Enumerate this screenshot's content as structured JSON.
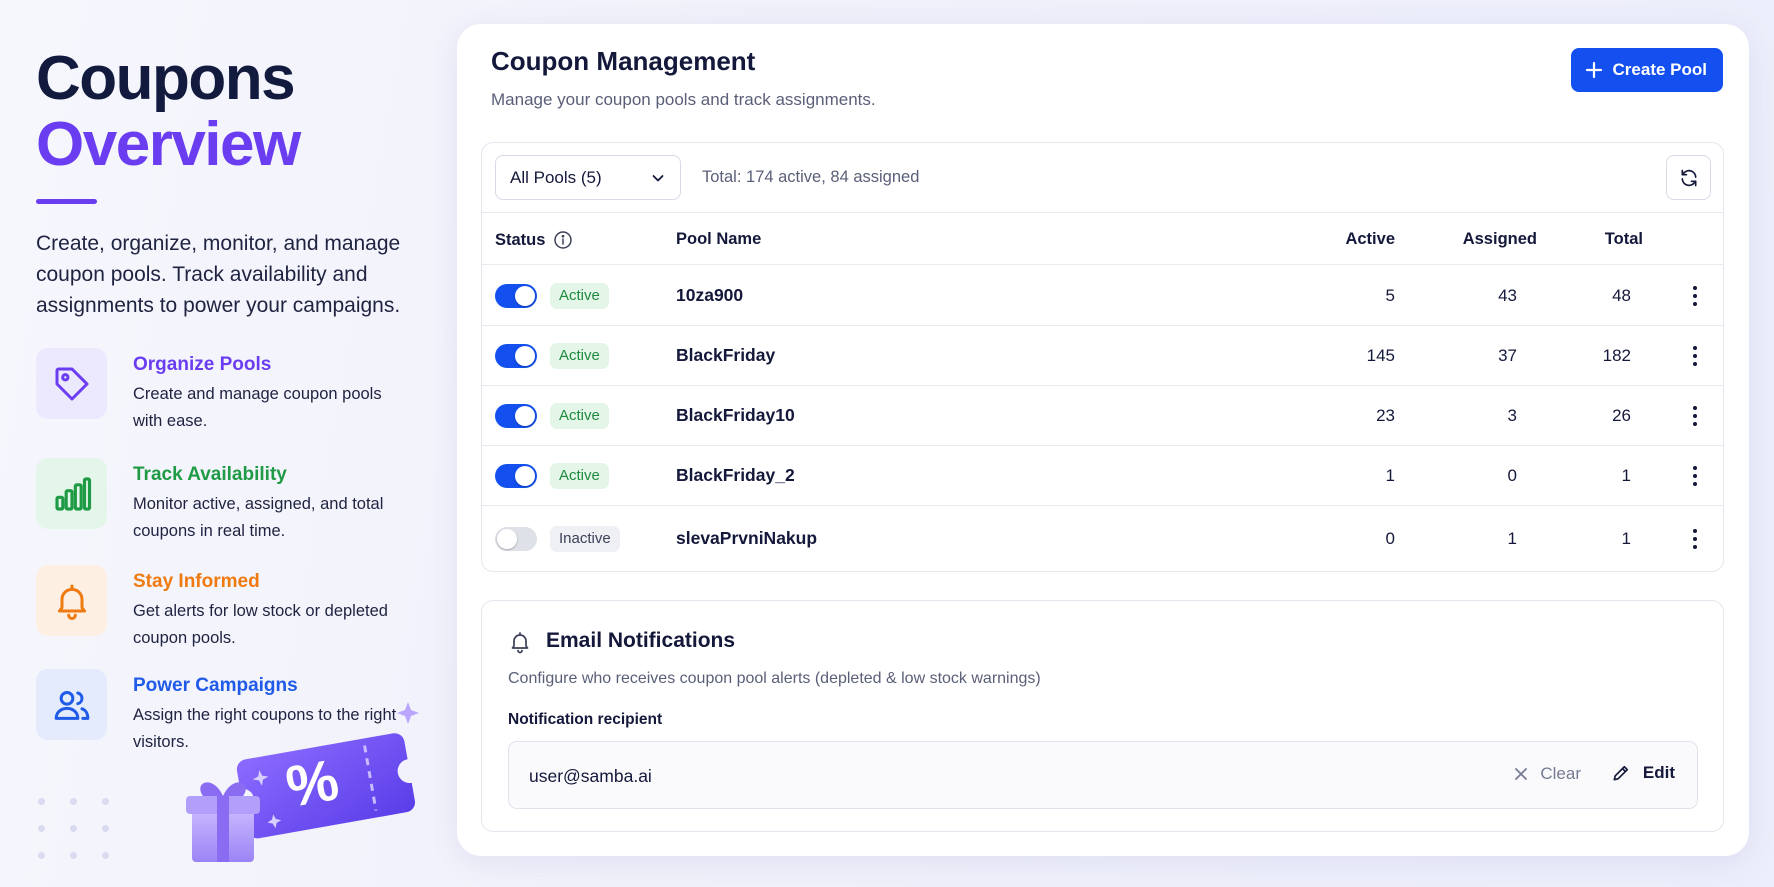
{
  "hero": {
    "title_line1": "Coupons",
    "title_line2": "Overview",
    "description": "Create, organize, monitor, and manage coupon pools. Track availability and assignments to power your campaigns."
  },
  "features": [
    {
      "title": "Organize Pools",
      "description": "Create and manage coupon pools with ease.",
      "icon": "tag-icon",
      "color": "#6a3df0",
      "bg": "#ece8fd"
    },
    {
      "title": "Track Availability",
      "description": "Monitor active, assigned, and total coupons in real time.",
      "icon": "bar-chart-icon",
      "color": "#1f9a45",
      "bg": "#e4f6e9"
    },
    {
      "title": "Stay Informed",
      "description": "Get alerts for low stock or depleted coupon pools.",
      "icon": "bell-icon",
      "color": "#f07a12",
      "bg": "#fdf0e3"
    },
    {
      "title": "Power Campaigns",
      "description": "Assign the right coupons to the right visitors.",
      "icon": "users-icon",
      "color": "#1f5ae8",
      "bg": "#e3ebfd"
    }
  ],
  "illustration": {
    "coupon_symbol": "%"
  },
  "main": {
    "title": "Coupon Management",
    "subtitle": "Manage your coupon pools and track assignments.",
    "create_button": "Create Pool"
  },
  "pools": {
    "filter_value": "All Pools (5)",
    "total_text": "Total: 174 active, 84 assigned",
    "columns": {
      "status": "Status",
      "name": "Pool Name",
      "active": "Active",
      "assigned": "Assigned",
      "total": "Total"
    },
    "rows": [
      {
        "enabled": true,
        "status": "Active",
        "name": "10za900",
        "active": "5",
        "assigned": "43",
        "total": "48"
      },
      {
        "enabled": true,
        "status": "Active",
        "name": "BlackFriday",
        "active": "145",
        "assigned": "37",
        "total": "182"
      },
      {
        "enabled": true,
        "status": "Active",
        "name": "BlackFriday10",
        "active": "23",
        "assigned": "3",
        "total": "26"
      },
      {
        "enabled": true,
        "status": "Active",
        "name": "BlackFriday_2",
        "active": "1",
        "assigned": "0",
        "total": "1"
      },
      {
        "enabled": false,
        "status": "Inactive",
        "name": "slevaPrvniNakup",
        "active": "0",
        "assigned": "1",
        "total": "1"
      }
    ]
  },
  "email": {
    "title": "Email Notifications",
    "subtitle": "Configure who receives coupon pool alerts (depleted & low stock warnings)",
    "label": "Notification recipient",
    "recipient": "user@samba.ai",
    "clear_label": "Clear",
    "edit_label": "Edit"
  },
  "colors": {
    "accent": "#1450f0",
    "brand_purple": "#6a3df0",
    "active_green": "#1f8a3e"
  }
}
